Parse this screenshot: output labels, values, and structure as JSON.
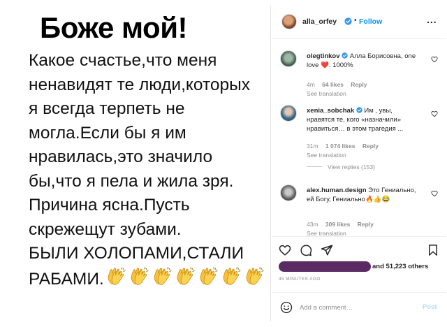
{
  "post_image": {
    "heading": "Боже мой!",
    "lines": [
      "Какое счастье,что меня",
      "ненавидят те люди,которых",
      "я всегда терпеть не",
      "могла.Если бы я им",
      "нравилась,это значило",
      "бы,что я пела и жила зря.",
      "Причина ясна.Пусть",
      "скрежещут зубами.",
      "БЫЛИ ХОЛОПАМИ,СТАЛИ",
      "РАБАМИ."
    ],
    "clap_icon": "clapping-hands-emoji",
    "clap_count": 7
  },
  "header": {
    "username": "alla_orfey",
    "separator": "•",
    "follow_label": "Follow",
    "more_label": "...",
    "verified_icon": "verified-badge-icon"
  },
  "comments": [
    {
      "username": "olegtinkov",
      "text": "Алла Борисовна, one love ❤️. 1000%",
      "time": "4m",
      "likes": "64 likes",
      "reply": "Reply",
      "translation": "See translation",
      "verified": true
    },
    {
      "username": "xenia_sobchak",
      "text": "Им , увы, нравятся те, кого «назначили» нравиться… в этом трагедия ...",
      "time": "31m",
      "likes": "1 074 likes",
      "reply": "Reply",
      "translation": "See translation",
      "verified": true
    },
    {
      "username": "alex.human.design",
      "text": "Это Гениально, ей Богу, Гениально🔥👍😂",
      "time": "43m",
      "likes": "309 likes",
      "reply": "Reply",
      "translation": "See translation",
      "verified": false
    }
  ],
  "view_replies": "View replies (153)",
  "likes": {
    "text": "and 51,223 others"
  },
  "timestamp": "45 MINUTES AGO",
  "add_comment": {
    "placeholder": "Add a comment…",
    "post_label": "Post"
  },
  "colors": {
    "accent": "#0095f6",
    "verified": "#3897f0",
    "redacted": "#5a2a63",
    "muted": "#8e8e8e"
  }
}
